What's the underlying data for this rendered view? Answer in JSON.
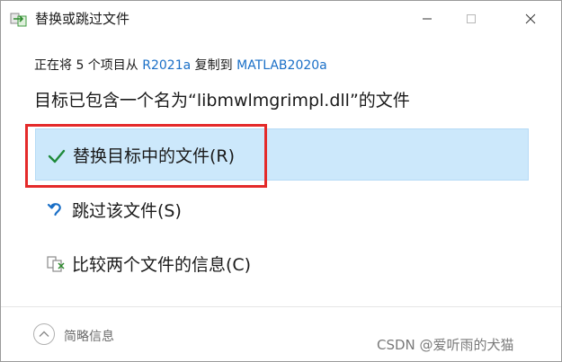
{
  "window": {
    "title": "替换或跳过文件"
  },
  "titlebar": {
    "minimize_icon": "minimize-icon",
    "maximize_icon": "maximize-icon",
    "close_icon": "close-icon"
  },
  "copy_status": {
    "prefix": "正在将 5 个项目从 ",
    "source": "R2021a",
    "middle": " 复制到 ",
    "destination": "MATLAB2020a"
  },
  "headline": "目标已包含一个名为“libmwlmgrimpl.dll”的文件",
  "options": [
    {
      "label": "替换目标中的文件(R)",
      "icon": "checkmark-icon",
      "selected": true
    },
    {
      "label": "跳过该文件(S)",
      "icon": "skip-arrow-icon",
      "selected": false
    },
    {
      "label": "比较两个文件的信息(C)",
      "icon": "compare-files-icon",
      "selected": false
    }
  ],
  "footer": {
    "details_label": "简略信息",
    "icon": "chevron-up-icon"
  },
  "watermark": "CSDN @爱听雨的犬猫",
  "colors": {
    "selected_bg": "#cce8fb",
    "link": "#1a6fc7",
    "annotation_red": "#e42a2a",
    "check_green": "#1e8a3a",
    "skip_blue": "#1a6fc7"
  }
}
